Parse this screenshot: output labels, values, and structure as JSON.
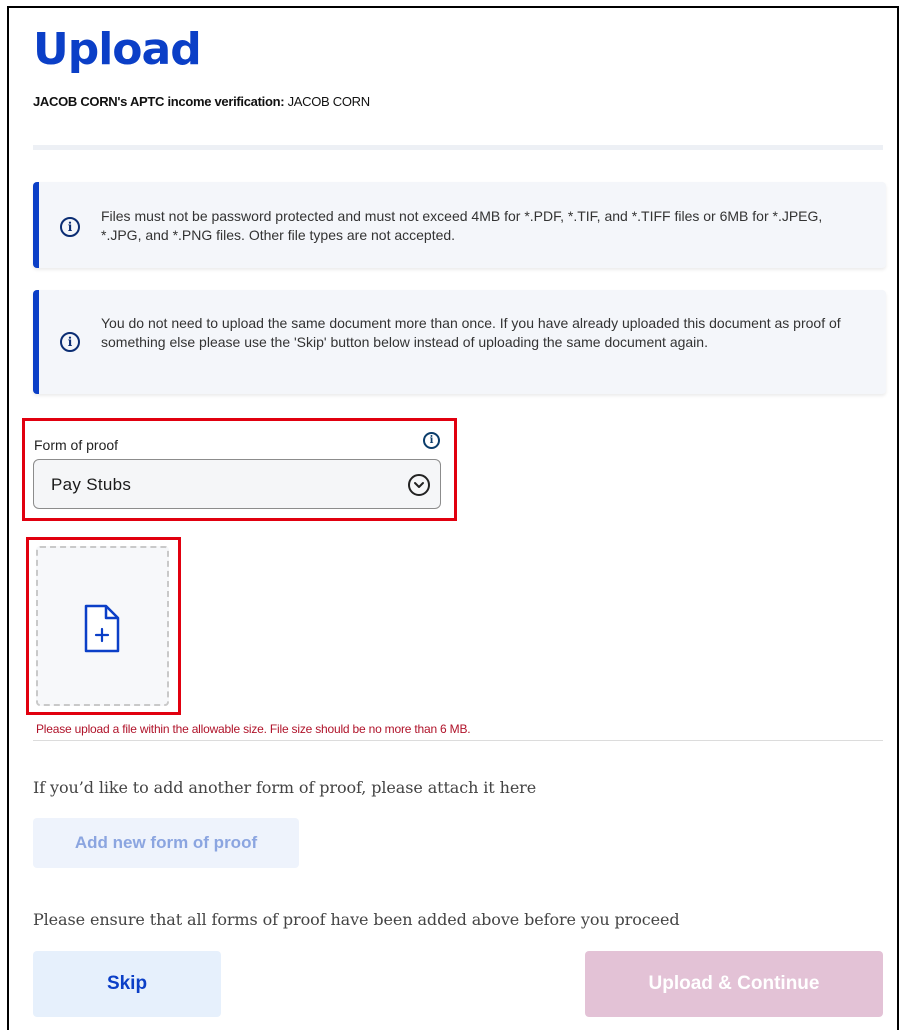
{
  "page": {
    "title": "Upload",
    "subtitle_bold": "JACOB CORN's APTC income verification:",
    "subtitle_value": "JACOB CORN"
  },
  "alerts": [
    {
      "icon": "info-icon",
      "text": "Files must not be password protected and must not exceed 4MB for *.PDF, *.TIF, and *.TIFF files or 6MB for *.JPEG, *.JPG, and *.PNG files. Other file types are not accepted."
    },
    {
      "icon": "info-icon",
      "text": "You do not need to upload the same document more than once. If you have already uploaded this document as proof of something else please use the 'Skip' button below instead of uploading the same document again."
    }
  ],
  "form": {
    "label": "Form of proof",
    "selected_value": "Pay Stubs",
    "icon": "chevron-down-icon"
  },
  "dropzone": {
    "icon": "file-add-icon",
    "error": "Please upload a file within the allowable size. File size should be no more than 6 MB."
  },
  "add_proof": {
    "prompt": "If you’d like to add another form of proof, please attach it here",
    "button_label": "Add new form of proof"
  },
  "footer": {
    "prompt": "Please ensure that all forms of proof have been added above before you proceed",
    "skip_label": "Skip",
    "upload_label": "Upload & Continue"
  },
  "colors": {
    "primary": "#0b3fc7",
    "error": "#b0132a",
    "highlight": "#e1000f",
    "disabled_button": "#e3c2d6"
  }
}
